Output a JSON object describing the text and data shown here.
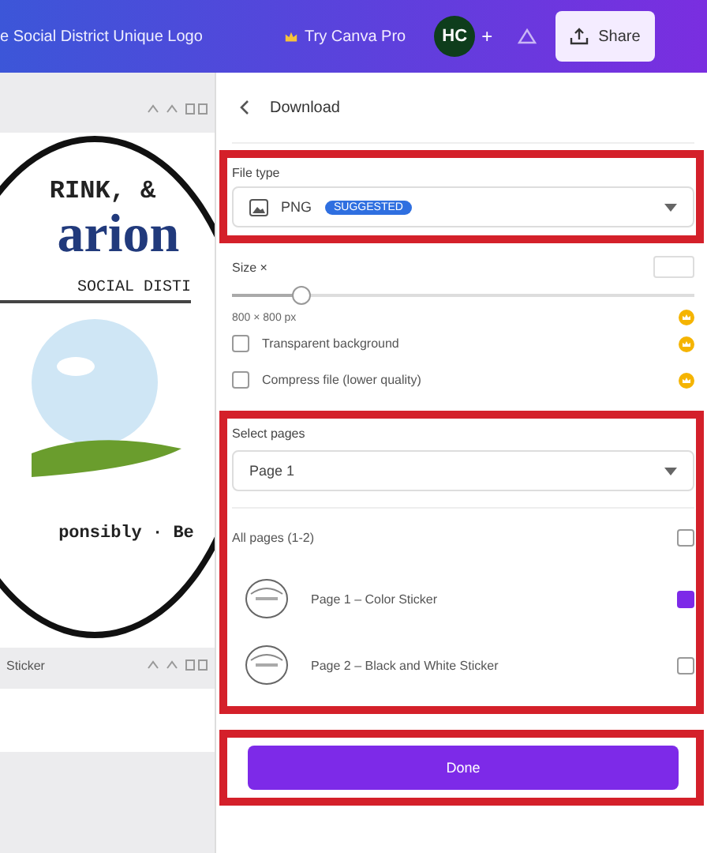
{
  "header": {
    "title": "e Social District Unique Logo",
    "pro_button": "Try Canva Pro",
    "avatar": "HC",
    "add": "+",
    "share": "Share"
  },
  "canvas": {
    "pages": [
      {
        "logo": {
          "top": "RINK, &",
          "name": "arion",
          "band": "SOCIAL DISTI",
          "bottom": "ponsibly · Be"
        }
      },
      {
        "label": "Sticker"
      }
    ]
  },
  "panel": {
    "title": "Download",
    "file_type": {
      "label": "File type",
      "value": "PNG",
      "badge": "SUGGESTED",
      "highlighted": true
    },
    "size": {
      "label": "Size ×",
      "level": 0.15,
      "reading": "800 × 800 px",
      "pro": true
    },
    "options": [
      {
        "label": "Transparent background",
        "checked": false,
        "pro": true
      },
      {
        "label": "Compress file (lower quality)",
        "checked": false,
        "pro": true
      }
    ],
    "select_pages": {
      "label": "Select pages",
      "value": "Page 1",
      "highlighted": true,
      "all": {
        "label": "All pages (1-2)",
        "checked": false
      },
      "items": [
        {
          "label": "Page 1 – Color Sticker",
          "checked": true
        },
        {
          "label": "Page 2 – Black and White Sticker",
          "checked": false
        }
      ]
    },
    "done": {
      "label": "Done",
      "highlighted": true
    }
  }
}
